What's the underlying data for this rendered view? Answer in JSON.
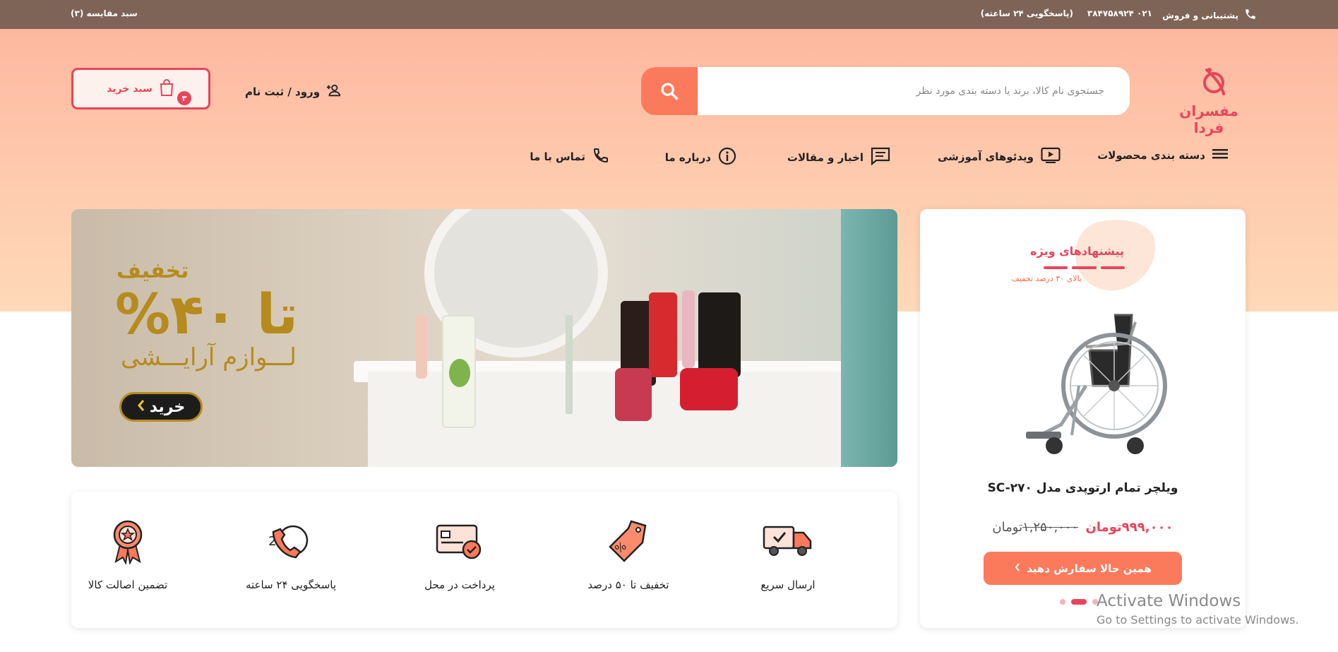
{
  "topbar": {
    "support_label": "پشتیبانی و فروش",
    "phone": "۰۲۱ ۳۸۴۷۵۸۹۲۴",
    "hours": "(پاسخگویی ۲۴ ساعته)",
    "compare": "سبد مقایسه (۳)"
  },
  "logo": {
    "text": "مفسران فردا"
  },
  "search": {
    "placeholder": "جستجوی نام کالا، برند یا دسته بندی مورد نظر"
  },
  "account": {
    "login_label": "ورود / ثبت نام"
  },
  "cart": {
    "label": "سبد خرید",
    "count": "۳"
  },
  "nav": {
    "categories": "دسته بندی محصولات",
    "videos": "ویدئوهای آموزشی",
    "news": "اخبار و مقالات",
    "about": "درباره ما",
    "contact": "تماس با ما"
  },
  "banner": {
    "discount": "تا ۴۰%",
    "discount_word": "تخفیف",
    "subtitle": "لـــوازم آرایـــشی",
    "buy_label": "خرید"
  },
  "features": [
    {
      "label": "ارسال سریع",
      "icon": "truck-icon"
    },
    {
      "label": "تخفیف تا ۵۰ درصد",
      "icon": "discount-tag-icon"
    },
    {
      "label": "پرداخت در محل",
      "icon": "card-payment-icon"
    },
    {
      "label": "پاسخگویی ۲۴ ساعته",
      "icon": "support-24-icon"
    },
    {
      "label": "تضمین اصالت کالا",
      "icon": "medal-icon"
    }
  ],
  "special_offer": {
    "title": "پیشنهادهای ویژه",
    "subtitle": "بالای ۳۰ درصد تخفیف",
    "product_name": "ویلچر تمام ارتوپدی مدل SC-۲۷۰",
    "old_price": "۱,۲۵۰,۰۰۰",
    "old_currency": "تومان",
    "new_price": "۹۹۹,۰۰۰",
    "new_currency": "تومان",
    "order_label": "همین حالا سفارش دهید"
  },
  "watermark": {
    "line1": "Activate Windows",
    "line2": "Go to Settings to activate Windows."
  },
  "colors": {
    "topbar": "#7e6357",
    "accent": "#fc7a5c",
    "brand": "#e8455a",
    "banner_gold": "#b58b1e"
  }
}
